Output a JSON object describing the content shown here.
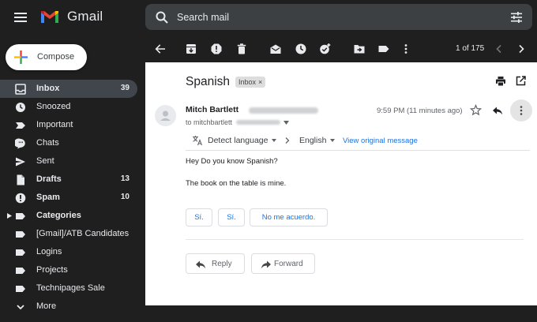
{
  "app": {
    "brand": "Gmail"
  },
  "search": {
    "placeholder": "Search mail"
  },
  "compose": {
    "label": "Compose"
  },
  "sidebar": {
    "items": [
      {
        "label": "Inbox",
        "count": "39",
        "icon": "inbox-icon"
      },
      {
        "label": "Snoozed",
        "count": "",
        "icon": "snooze-icon"
      },
      {
        "label": "Important",
        "count": "",
        "icon": "important-icon"
      },
      {
        "label": "Chats",
        "count": "",
        "icon": "chat-icon"
      },
      {
        "label": "Sent",
        "count": "",
        "icon": "send-icon"
      },
      {
        "label": "Drafts",
        "count": "13",
        "icon": "draft-icon"
      },
      {
        "label": "Spam",
        "count": "10",
        "icon": "spam-icon"
      },
      {
        "label": "Categories",
        "count": "",
        "icon": "label-icon"
      },
      {
        "label": "[Gmail]/ATB Candidates",
        "count": "",
        "icon": "label-icon"
      },
      {
        "label": "Logins",
        "count": "",
        "icon": "label-icon"
      },
      {
        "label": "Projects",
        "count": "",
        "icon": "label-icon"
      },
      {
        "label": "Technipages Sale",
        "count": "",
        "icon": "label-icon"
      },
      {
        "label": "More",
        "count": "",
        "icon": "chevron-down-icon"
      }
    ]
  },
  "toolbar": {
    "page_count": "1 of 175"
  },
  "email": {
    "subject": "Spanish",
    "label": "Inbox",
    "sender_name": "Mitch Bartlett",
    "to_prefix": "to mitchbartlett",
    "timestamp": "9:59 PM (11 minutes ago)",
    "translate": {
      "detect": "Detect language",
      "target": "English",
      "view_original": "View original message"
    },
    "body": [
      "Hey Do you know Spanish?",
      "The book on the table is mine."
    ],
    "smart_replies": [
      "Sí.",
      "Sí.",
      "No me acuerdo."
    ],
    "reply_label": "Reply",
    "forward_label": "Forward"
  },
  "colors": {
    "background": "#1f1f1f",
    "active_item": "#41464c",
    "search_bg": "#3c4043",
    "link_blue": "#1a73e8"
  }
}
